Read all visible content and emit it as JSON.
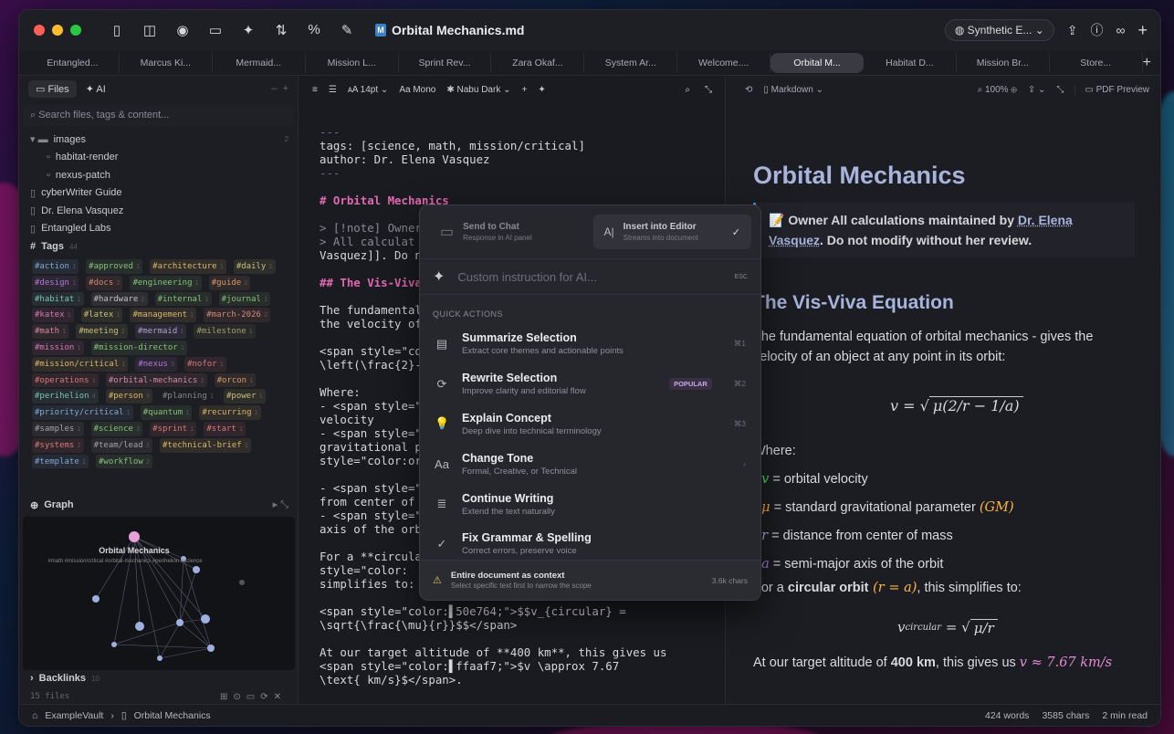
{
  "colors": {
    "accent": "#a8b4dc",
    "heading_md": "#e06ab0",
    "close": "#ff5f57",
    "min": "#febc2e",
    "max": "#28c840"
  },
  "titlebar": {
    "doc_title": "Orbital Mechanics.md",
    "theme": "Synthetic E..."
  },
  "tabs": [
    "Entangled...",
    "Marcus Ki...",
    "Mermaid...",
    "Mission L...",
    "Sprint Rev...",
    "Zara Okaf...",
    "System Ar...",
    "Welcome....",
    "Orbital M...",
    "Habitat D...",
    "Mission Br...",
    "Store..."
  ],
  "sidebar": {
    "tab_files": "Files",
    "tab_ai": "AI",
    "search_placeholder": "Search files, tags & content...",
    "tree": [
      {
        "label": "images",
        "count": "2",
        "child": false
      },
      {
        "label": "habitat-render",
        "child": true
      },
      {
        "label": "nexus-patch",
        "child": true
      },
      {
        "label": "cyberWriter Guide",
        "child": false
      },
      {
        "label": "Dr. Elena Vasquez",
        "child": false
      },
      {
        "label": "Entangled Labs",
        "child": false
      }
    ],
    "tags_label": "Tags",
    "tags_count": "44",
    "tags": [
      {
        "t": "#action",
        "n": "1",
        "c": "#7fa9d4"
      },
      {
        "t": "#approved",
        "n": "1",
        "c": "#86c07a"
      },
      {
        "t": "#architecture",
        "n": "1",
        "c": "#d9b86a"
      },
      {
        "t": "#daily",
        "n": "1",
        "c": "#c7c07a"
      },
      {
        "t": "#design",
        "n": "1",
        "c": "#b07ad4"
      },
      {
        "t": "#docs",
        "n": "2",
        "c": "#d48a7a"
      },
      {
        "t": "#engineering",
        "n": "1",
        "c": "#86c07a"
      },
      {
        "t": "#guide",
        "n": "2",
        "c": "#d49a6a"
      },
      {
        "t": "#habitat",
        "n": "1",
        "c": "#7ac0b0"
      },
      {
        "t": "#hardware",
        "n": "1",
        "c": "#c0c0c6"
      },
      {
        "t": "#internal",
        "n": "1",
        "c": "#86c07a"
      },
      {
        "t": "#journal",
        "n": "1",
        "c": "#86c07a"
      },
      {
        "t": "#katex",
        "n": "1",
        "c": "#d47ab0"
      },
      {
        "t": "#latex",
        "n": "1",
        "c": "#c7c07a"
      },
      {
        "t": "#management",
        "n": "1",
        "c": "#d9b86a"
      },
      {
        "t": "#march-2026",
        "n": "2",
        "c": "#d48a7a"
      },
      {
        "t": "#math",
        "n": "1",
        "c": "#d48aa0"
      },
      {
        "t": "#meeting",
        "n": "2",
        "c": "#c7c07a"
      },
      {
        "t": "#mermaid",
        "n": "1",
        "c": "#b0a0d4"
      },
      {
        "t": "#milestone",
        "n": "1",
        "c": "#a0a070"
      },
      {
        "t": "#mission",
        "n": "1",
        "c": "#d47ab0"
      },
      {
        "t": "#mission-director",
        "n": "1",
        "c": "#86c07a"
      },
      {
        "t": "#mission/critical",
        "n": "1",
        "c": "#d9b86a"
      },
      {
        "t": "#nexus",
        "n": "3",
        "c": "#b07ad4"
      },
      {
        "t": "#nofor",
        "n": "1",
        "c": "#d47a7a"
      },
      {
        "t": "#operations",
        "n": "1",
        "c": "#d47a7a"
      },
      {
        "t": "#orbital-mechanics",
        "n": "2",
        "c": "#d48aa0"
      },
      {
        "t": "#orcon",
        "n": "1",
        "c": "#d49a6a"
      },
      {
        "t": "#perihelion",
        "n": "4",
        "c": "#7ac0b0"
      },
      {
        "t": "#person",
        "n": "9",
        "c": "#d9b86a"
      },
      {
        "t": "#planning",
        "n": "1",
        "c": "#888"
      },
      {
        "t": "#power",
        "n": "1",
        "c": "#c7c07a"
      },
      {
        "t": "#priority/critical",
        "n": "1",
        "c": "#7fa9d4"
      },
      {
        "t": "#quantum",
        "n": "1",
        "c": "#86c07a"
      },
      {
        "t": "#recurring",
        "n": "1",
        "c": "#d9b86a"
      },
      {
        "t": "#samples",
        "n": "1",
        "c": "#a0a0a6"
      },
      {
        "t": "#science",
        "n": "3",
        "c": "#86c07a"
      },
      {
        "t": "#sprint",
        "n": "1",
        "c": "#d47a7a"
      },
      {
        "t": "#start",
        "n": "1",
        "c": "#d47a7a"
      },
      {
        "t": "#systems",
        "n": "2",
        "c": "#d47a7a"
      },
      {
        "t": "#team/lead",
        "n": "3",
        "c": "#a0a0a6"
      },
      {
        "t": "#technical-brief",
        "n": "1",
        "c": "#d9b86a"
      },
      {
        "t": "#template",
        "n": "1",
        "c": "#7fa9d4"
      },
      {
        "t": "#workflow",
        "n": "2",
        "c": "#86c07a"
      }
    ],
    "graph_label": "Graph",
    "graph_title": "Orbital Mechanics",
    "graph_tags": "#math #mission/critical #orbital-mechanics #perihelion #science",
    "backlinks_label": "Backlinks",
    "backlinks_count": "10",
    "files_count": "15 files"
  },
  "editor": {
    "font_size": "14pt",
    "font": "Mono",
    "theme": "Nabu Dark",
    "lines": [
      {
        "t": "---",
        "c": "dim"
      },
      {
        "t": "tags: [science, math, mission/critical]",
        "c": ""
      },
      {
        "t": "author: Dr. Elena Vasquez",
        "c": ""
      },
      {
        "t": "---",
        "c": "dim"
      },
      {
        "t": "",
        "c": ""
      },
      {
        "t": "# Orbital Mechanics",
        "c": "h"
      },
      {
        "t": "",
        "c": ""
      },
      {
        "t": "> [!note] Owner",
        "c": "q"
      },
      {
        "t": "> All calculat",
        "c": "q"
      },
      {
        "t": "Vasquez]]. Do n",
        "c": ""
      },
      {
        "t": "",
        "c": ""
      },
      {
        "t": "## The Vis-Viva",
        "c": "h"
      },
      {
        "t": "",
        "c": ""
      },
      {
        "t": "The fundamental",
        "c": ""
      },
      {
        "t": "the velocity of",
        "c": ""
      },
      {
        "t": "",
        "c": ""
      },
      {
        "t": "<span style=\"co",
        "c": ""
      },
      {
        "t": "\\left(\\frac{2}-",
        "c": ""
      },
      {
        "t": "",
        "c": ""
      },
      {
        "t": "Where:",
        "c": ""
      },
      {
        "t": "- <span style=\"",
        "c": ""
      },
      {
        "t": "velocity",
        "c": ""
      },
      {
        "t": "- <span style=\"",
        "c": ""
      },
      {
        "t": "gravitational p",
        "c": ""
      },
      {
        "t": "style=\"color:or",
        "c": ""
      },
      {
        "t": "",
        "c": ""
      },
      {
        "t": "- <span style=\"",
        "c": ""
      },
      {
        "t": "from center of",
        "c": ""
      },
      {
        "t": "- <span style=\"",
        "c": ""
      },
      {
        "t": "axis of the orb",
        "c": ""
      },
      {
        "t": "",
        "c": ""
      },
      {
        "t": "For a **circula",
        "c": ""
      },
      {
        "t": "style=\"color:",
        "c": ""
      },
      {
        "t": "simplifies to:",
        "c": ""
      },
      {
        "t": "",
        "c": ""
      },
      {
        "t": "<span style=\"color:▌50e764;\">$$v_{circular} =",
        "c": ""
      },
      {
        "t": "\\sqrt{\\frac{\\mu}{r}}$$</span>",
        "c": ""
      },
      {
        "t": "",
        "c": ""
      },
      {
        "t": "At our target altitude of **400 km**, this gives us",
        "c": ""
      },
      {
        "t": "<span style=\"color:▌ffaaf7;\">$v \\approx 7.67",
        "c": ""
      },
      {
        "t": "\\text{ km/s}$</span>.",
        "c": ""
      }
    ]
  },
  "preview": {
    "mode": "Markdown",
    "zoom": "100%",
    "pdf": "PDF Preview",
    "h1": "Orbital Mechanics",
    "callout_prefix": "📝 Owner All calculations maintained by ",
    "callout_link": "Dr. Elena Vasquez",
    "callout_suffix": ". Do not modify without her review.",
    "h2": "The Vis-Viva Equation",
    "p1": "The fundamental equation of orbital mechanics - gives the velocity of an object at any point in its orbit:",
    "where": "Where:",
    "bullets": [
      {
        "sym": "v",
        "text": " = orbital velocity",
        "c": "#50e764"
      },
      {
        "sym": "μ",
        "text": " = standard gravitational parameter ",
        "c": "#ffb347",
        "extra": "(GM)"
      },
      {
        "sym": "r",
        "text": " = distance from center of mass",
        "c": "#a8b4dc"
      },
      {
        "sym": "a",
        "text": " = semi-major axis of the orbit",
        "c": "#b07ad4"
      }
    ],
    "p2_pre": "For a ",
    "p2_bold": "circular orbit",
    "p2_math": " (r = a)",
    "p2_post": ", this simplifies to:",
    "p3_pre": "At our target altitude of ",
    "p3_bold": "400 km",
    "p3_post": ", this gives us ",
    "p3_math": "v ≈ 7.67 km/s"
  },
  "status": {
    "vault": "ExampleVault",
    "file": "Orbital Mechanics",
    "words": "424 words",
    "chars": "3585 chars",
    "read": "2 min read"
  },
  "ai_popup": {
    "send_chat": "Send to Chat",
    "send_chat_sub": "Response in AI panel",
    "insert": "Insert into Editor",
    "insert_sub": "Streams into document",
    "placeholder": "Custom instruction for AI...",
    "esc": "ESC",
    "qa_head": "QUICK ACTIONS",
    "actions": [
      {
        "icon": "▤",
        "name": "summarize-icon",
        "t": "Summarize Selection",
        "s": "Extract core themes and actionable points",
        "k": "⌘1",
        "badge": ""
      },
      {
        "icon": "⟳",
        "name": "rewrite-icon",
        "t": "Rewrite Selection",
        "s": "Improve clarity and editorial flow",
        "k": "⌘2",
        "badge": "POPULAR"
      },
      {
        "icon": "💡",
        "name": "lightbulb-icon",
        "t": "Explain Concept",
        "s": "Deep dive into technical terminology",
        "k": "⌘3",
        "badge": ""
      },
      {
        "icon": "Aa",
        "name": "tone-icon",
        "t": "Change Tone",
        "s": "Formal, Creative, or Technical",
        "k": "›",
        "badge": ""
      },
      {
        "icon": "≣",
        "name": "continue-icon",
        "t": "Continue Writing",
        "s": "Extend the text naturally",
        "k": "",
        "badge": ""
      },
      {
        "icon": "✓",
        "name": "grammar-icon",
        "t": "Fix Grammar & Spelling",
        "s": "Correct errors, preserve voice",
        "k": "",
        "badge": ""
      }
    ],
    "ctx_title": "Entire document as context",
    "ctx_sub": "Select specific text first to narrow the scope",
    "ctx_chars": "3.6k chars"
  }
}
